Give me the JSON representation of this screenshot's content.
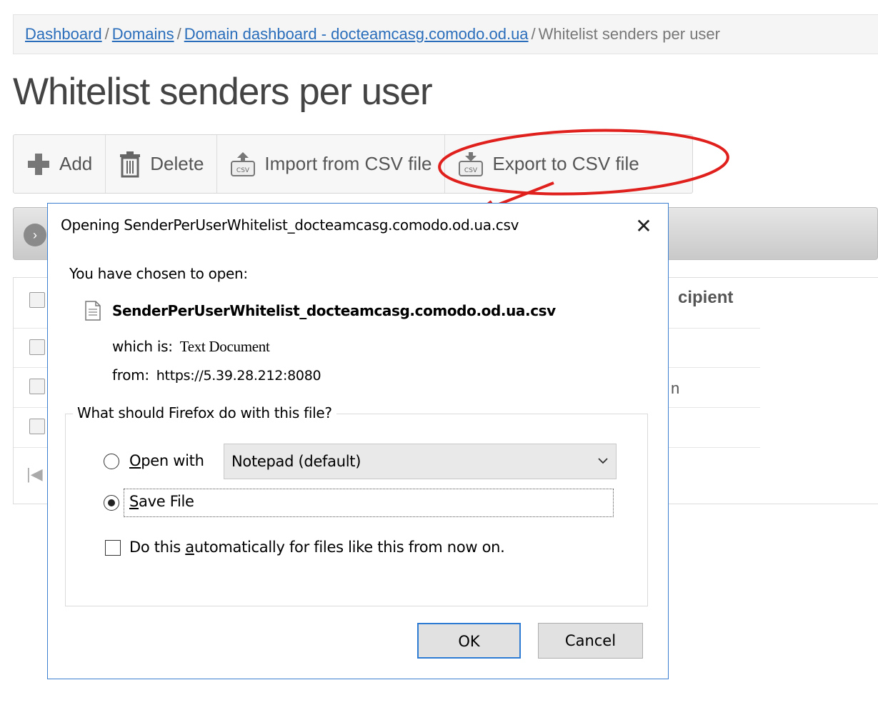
{
  "breadcrumb": {
    "items": [
      {
        "label": "Dashboard"
      },
      {
        "label": "Domains"
      },
      {
        "label": "Domain dashboard - docteamcasg.comodo.od.ua"
      },
      {
        "label": "Whitelist senders per user"
      }
    ],
    "separator": "/"
  },
  "page": {
    "title": "Whitelist senders per user"
  },
  "toolbar": {
    "add_label": "Add",
    "delete_label": "Delete",
    "import_label": "Import from CSV file",
    "export_label": "Export to CSV file"
  },
  "grid": {
    "partial_header": "cipient",
    "partial_cell": "n"
  },
  "dialog": {
    "title": "Opening SenderPerUserWhitelist_docteamcasg.comodo.od.ua.csv",
    "close_glyph": "✕",
    "chosen_label": "You have chosen to open:",
    "file_name": "SenderPerUserWhitelist_docteamcasg.comodo.od.ua.csv",
    "type_key": "which is:",
    "type_value": "Text Document",
    "from_key": "from:",
    "from_value": "https://5.39.28.212:8080",
    "group_legend": "What should Firefox do with this file?",
    "open_with_label": "pen with",
    "open_with_access": "O",
    "open_with_app": "Notepad (default)",
    "save_file_label": "ave File",
    "save_file_access": "S",
    "selected_option": "save",
    "auto_pre": "Do this ",
    "auto_access": "a",
    "auto_post": "utomatically for files like this from now on.",
    "auto_checked": false,
    "ok_label": "OK",
    "cancel_label": "Cancel"
  },
  "colors": {
    "link": "#2a6ebb",
    "dialog_border": "#3c7fd0",
    "annotation": "#e0201c"
  }
}
